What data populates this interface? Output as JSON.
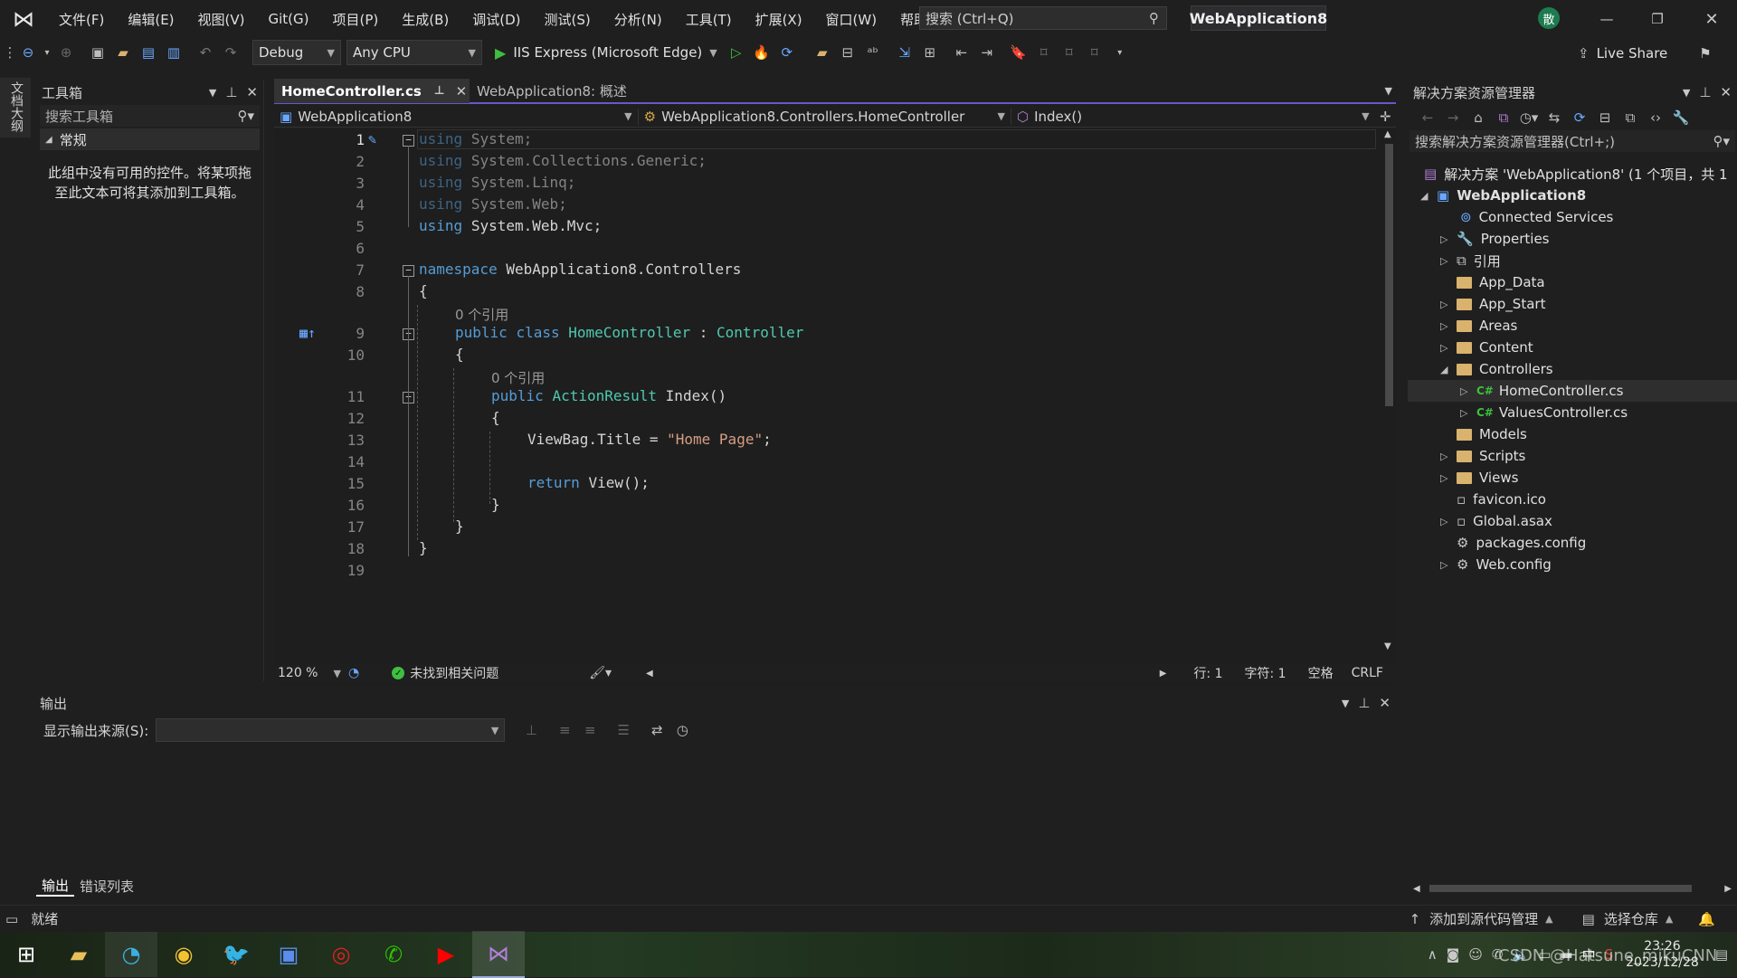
{
  "menu": [
    "文件(F)",
    "编辑(E)",
    "视图(V)",
    "Git(G)",
    "项目(P)",
    "生成(B)",
    "调试(D)",
    "测试(S)",
    "分析(N)",
    "工具(T)",
    "扩展(X)",
    "窗口(W)",
    "帮助(H)"
  ],
  "search": {
    "placeholder": "搜索 (Ctrl+Q)"
  },
  "solution_name": "WebApplication8",
  "user_badge": "散",
  "toolbar": {
    "config": "Debug",
    "platform": "Any CPU",
    "run_target": "IIS Express (Microsoft Edge)",
    "live_share": "Live Share"
  },
  "left_rail": "文档大纲",
  "toolbox": {
    "title": "工具箱",
    "search_placeholder": "搜索工具箱",
    "group": "常规",
    "empty_text": "此组中没有可用的控件。将某项拖至此文本可将其添加到工具箱。"
  },
  "editor": {
    "tabs": [
      {
        "label": "HomeController.cs",
        "active": true
      },
      {
        "label": "WebApplication8: 概述",
        "active": false
      }
    ],
    "nav": {
      "project": "WebApplication8",
      "class": "WebApplication8.Controllers.HomeController",
      "member": "Index()"
    },
    "line_numbers": [
      "1",
      "2",
      "3",
      "4",
      "5",
      "6",
      "7",
      "8",
      "9",
      "10",
      "11",
      "12",
      "13",
      "14",
      "15",
      "16",
      "17",
      "18",
      "19"
    ],
    "refs_label": "0 个引用",
    "zoom": "120 %",
    "issues": "未找到相关问题",
    "line": "行: 1",
    "col": "字符: 1",
    "indent": "空格",
    "eol": "CRLF"
  },
  "code": {
    "using": "using",
    "ns_system": "System;",
    "ns_generic": "System.Collections.Generic;",
    "ns_linq": "System.Linq;",
    "ns_web": "System.Web;",
    "ns_mvc": "System.Web.Mvc;",
    "namespace_kw": "namespace",
    "namespace_name": "WebApplication8.Controllers",
    "public_kw": "public",
    "class_kw": "class",
    "class_name": "HomeController",
    "colon": ":",
    "base_class": "Controller",
    "return_type": "ActionResult",
    "method": "Index()",
    "viewbag": "ViewBag.Title = ",
    "title_string": "\"Home Page\"",
    "semicolon": ";",
    "return_kw": "return",
    "view_call": "View();",
    "open_brace": "{",
    "close_brace": "}"
  },
  "solution_explorer": {
    "title": "解决方案资源管理器",
    "search_placeholder": "搜索解决方案资源管理器(Ctrl+;)",
    "solution_line": "解决方案 'WebApplication8' (1 个项目，共 1",
    "project": "WebApplication8",
    "items": [
      "Connected Services",
      "Properties",
      "引用",
      "App_Data",
      "App_Start",
      "Areas",
      "Content",
      "Controllers",
      "HomeController.cs",
      "ValuesController.cs",
      "Models",
      "Scripts",
      "Views",
      "favicon.ico",
      "Global.asax",
      "packages.config",
      "Web.config"
    ]
  },
  "output": {
    "title": "输出",
    "source_label": "显示输出来源(S):",
    "tabs": [
      "输出",
      "错误列表"
    ]
  },
  "status": {
    "ready": "就绪",
    "add_source": "添加到源代码管理",
    "select_repo": "选择仓库"
  },
  "taskbar": {
    "time": "23:26",
    "date": "2023/12/28",
    "ime": "中",
    "watermark": "CSDN @Hatsune_mikuCNN"
  },
  "colors": {
    "accent": "#6b57c9",
    "keyword": "#569cd6",
    "type": "#4ec9b0",
    "string": "#d69d85",
    "folder": "#d9b26e",
    "run": "#3fbf3f"
  }
}
